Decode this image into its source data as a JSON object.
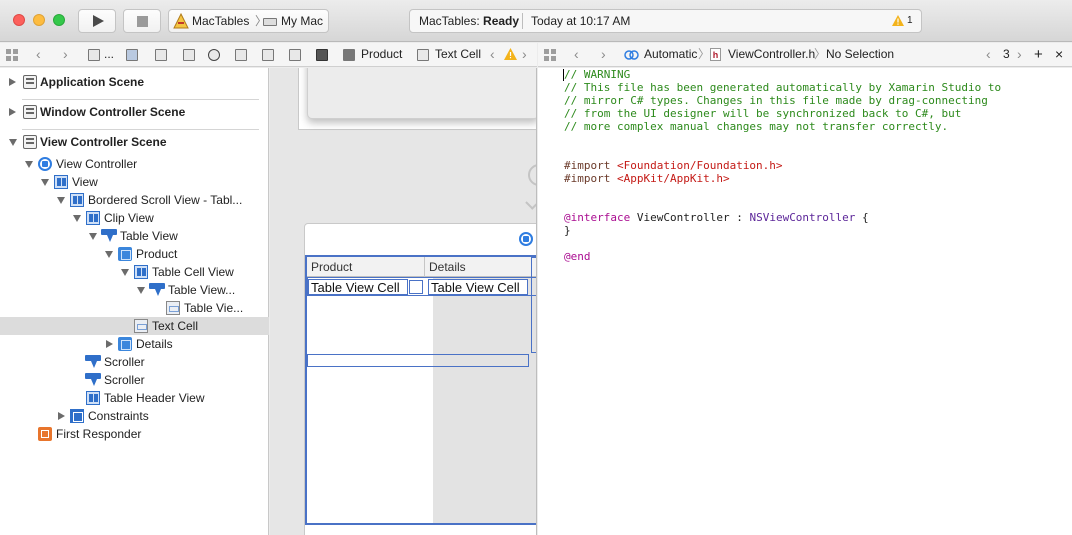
{
  "toolbar": {
    "scheme_app": "MacTables",
    "scheme_separator": "〉",
    "scheme_dest": "My Mac",
    "status_app": "MacTables:",
    "status_state": "Ready",
    "status_time": "Today at 10:17 AM",
    "warning_count": "1",
    "colors": {
      "close": "#fc605c",
      "minimize": "#fdbc40",
      "zoom": "#34c84a"
    }
  },
  "jumpbar_left": {
    "crumb_ellipsis": "...",
    "crumb_product": "Product",
    "crumb_textcell": "Text Cell"
  },
  "jumpbar_right": {
    "automatic": "Automatic",
    "file": "ViewController.h",
    "selection": "No Selection",
    "counter": "3",
    "add": "+",
    "close": "×"
  },
  "outline": {
    "scenes": [
      {
        "label": "Application Scene"
      },
      {
        "label": "Window Controller Scene"
      },
      {
        "label": "View Controller Scene"
      }
    ],
    "items": [
      {
        "label": "View Controller"
      },
      {
        "label": "View"
      },
      {
        "label": "Bordered Scroll View - Tabl..."
      },
      {
        "label": "Clip View"
      },
      {
        "label": "Table View"
      },
      {
        "label": "Product"
      },
      {
        "label": "Table Cell View"
      },
      {
        "label": "Table View..."
      },
      {
        "label": "Table Vie..."
      },
      {
        "label": "Text Cell"
      },
      {
        "label": "Details"
      },
      {
        "label": "Scroller"
      },
      {
        "label": "Scroller"
      },
      {
        "label": "Table Header View"
      },
      {
        "label": "Constraints"
      },
      {
        "label": "First Responder"
      }
    ]
  },
  "canvas": {
    "column_1": "Product",
    "column_2": "Details",
    "cell_1": "Table View Cell",
    "cell_2": "Table View Cell",
    "selection_color": "#4a72c6"
  },
  "editor": {
    "lines": [
      {
        "cls": "c-comment",
        "text": "// WARNING"
      },
      {
        "cls": "c-comment",
        "text": "// This file has been generated automatically by Xamarin Studio to"
      },
      {
        "cls": "c-comment",
        "text": "// mirror C# types. Changes in this file made by drag-connecting"
      },
      {
        "cls": "c-comment",
        "text": "// from the UI designer will be synchronized back to C#, but"
      },
      {
        "cls": "c-comment",
        "text": "// more complex manual changes may not transfer correctly."
      },
      {
        "cls": "",
        "text": ""
      },
      {
        "cls": "",
        "text": ""
      },
      {
        "cls": "c-pp",
        "text": "#import ",
        "str": "<Foundation/Foundation.h>"
      },
      {
        "cls": "c-pp",
        "text": "#import ",
        "str": "<AppKit/AppKit.h>"
      },
      {
        "cls": "",
        "text": ""
      },
      {
        "cls": "",
        "text": ""
      },
      {
        "cls": "iface",
        "kw": "@interface",
        "name": " ViewController : ",
        "type": "NSViewController",
        "rest": " {"
      },
      {
        "cls": "",
        "text": "}"
      },
      {
        "cls": "",
        "text": ""
      },
      {
        "cls": "c-kw",
        "text": "@end"
      }
    ]
  }
}
